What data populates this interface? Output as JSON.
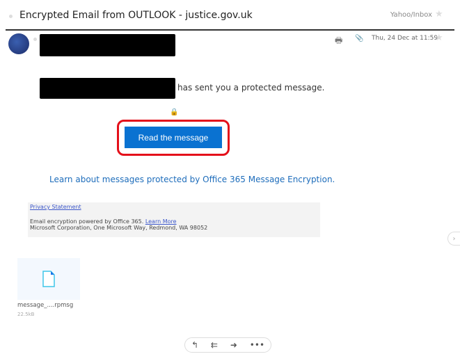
{
  "header": {
    "subject": "Encrypted Email from OUTLOOK - justice.gov.uk",
    "folder": "Yahoo/Inbox"
  },
  "message": {
    "date": "Thu, 24 Dec at 11:59",
    "body_text": "has sent you a protected message.",
    "read_button": "Read the message",
    "learn_link": "Learn about messages protected by Office 365 Message Encryption.",
    "footer": {
      "privacy": "Privacy Statement",
      "powered": "Email encryption powered by Office 365.",
      "learn_more": "Learn More",
      "address": "Microsoft Corporation, One Microsoft Way, Redmond, WA 98052"
    },
    "attachment": {
      "name": "message_....rpmsg",
      "size": "22.5kB"
    }
  },
  "colors": {
    "button": "#0a72d1",
    "highlight": "#e4101a",
    "link": "#1e6dbb"
  }
}
